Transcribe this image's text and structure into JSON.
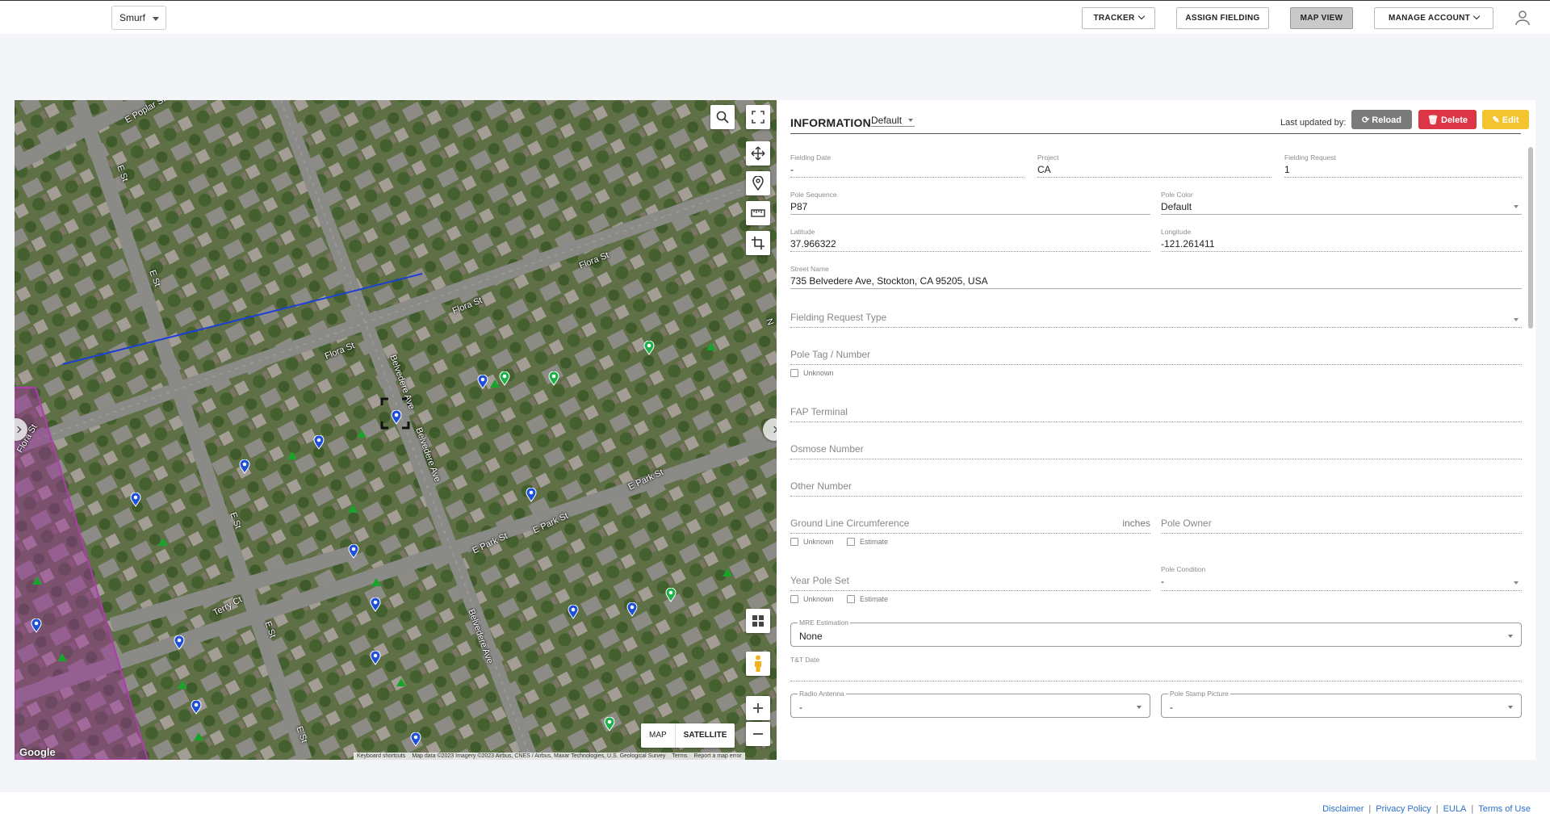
{
  "topbar": {
    "project": "Smurf",
    "tracker": "TRACKER",
    "assign_fielding": "ASSIGN FIELDING",
    "map_view": "MAP VIEW",
    "manage_account": "MANAGE ACCOUNT"
  },
  "map": {
    "type_map": "MAP",
    "type_satellite": "SATELLITE",
    "google": "Google",
    "attribution": {
      "shortcuts": "Keyboard shortcuts",
      "data": "Map data ©2023 Imagery ©2023 Airbus, CNES / Airbus, Maxar Technologies, U.S. Geological Survey",
      "terms": "Terms",
      "report": "Report a map error"
    },
    "streets": {
      "poplar": "E Poplar St",
      "e_st_1": "E St",
      "e_st_2": "E St",
      "e_st_3": "E St",
      "e_st_4": "E St",
      "e_st_5": "E St",
      "flora_1": "Flora St",
      "flora_2": "Flora St",
      "flora_3": "Flora St",
      "flora_4": "Flora St",
      "belvedere_1": "Belvedere Ave",
      "belvedere_2": "Belvedere Ave",
      "belvedere_3": "Belvedere Ave",
      "park_1": "E Park St",
      "park_2": "E Park St",
      "park_3": "E Park St",
      "terry": "Terry Ct",
      "n": "N"
    }
  },
  "info": {
    "title": "INFORMATION",
    "view": "Default",
    "last_updated": "Last updated by:",
    "reload": "Reload",
    "delete": "Delete",
    "edit": "Edit",
    "fields": {
      "fielding_date": {
        "label": "Fielding Date",
        "value": "-"
      },
      "project": {
        "label": "Project",
        "value": "CA"
      },
      "fielding_request": {
        "label": "Fielding Request",
        "value": "1"
      },
      "pole_sequence": {
        "label": "Pole Sequence",
        "value": "P87"
      },
      "pole_color": {
        "label": "Pole Color",
        "value": "Default"
      },
      "latitude": {
        "label": "Latitude",
        "value": "37.966322"
      },
      "longitude": {
        "label": "Longitude",
        "value": "-121.261411"
      },
      "street_name": {
        "label": "Street Name",
        "value": "735 Belvedere Ave, Stockton, CA 95205, USA"
      },
      "fielding_request_type": {
        "placeholder": "Fielding Request Type"
      },
      "pole_tag": {
        "placeholder": "Pole Tag / Number"
      },
      "fap_terminal": {
        "placeholder": "FAP Terminal"
      },
      "osmose_number": {
        "placeholder": "Osmose Number"
      },
      "other_number": {
        "placeholder": "Other Number"
      },
      "ground_line": {
        "placeholder": "Ground Line Circumference",
        "unit": "inches"
      },
      "pole_owner": {
        "placeholder": "Pole Owner"
      },
      "year_pole_set": {
        "placeholder": "Year Pole Set"
      },
      "pole_condition": {
        "label": "Pole Condition",
        "value": "-"
      },
      "mre_estimation": {
        "label": "MRE Estimation",
        "value": "None"
      },
      "tt_date": {
        "label": "T&T Date",
        "value": ""
      },
      "radio_antenna": {
        "label": "Radio Antenna",
        "value": "-"
      },
      "pole_stamp_picture": {
        "label": "Pole Stamp Picture",
        "value": "-"
      }
    },
    "checkbox": {
      "unknown": "Unknown",
      "estimate": "Estimate"
    }
  },
  "footer": {
    "disclaimer": "Disclaimer",
    "privacy": "Privacy Policy",
    "eula": "EULA",
    "terms": "Terms of Use",
    "sep": "|"
  }
}
